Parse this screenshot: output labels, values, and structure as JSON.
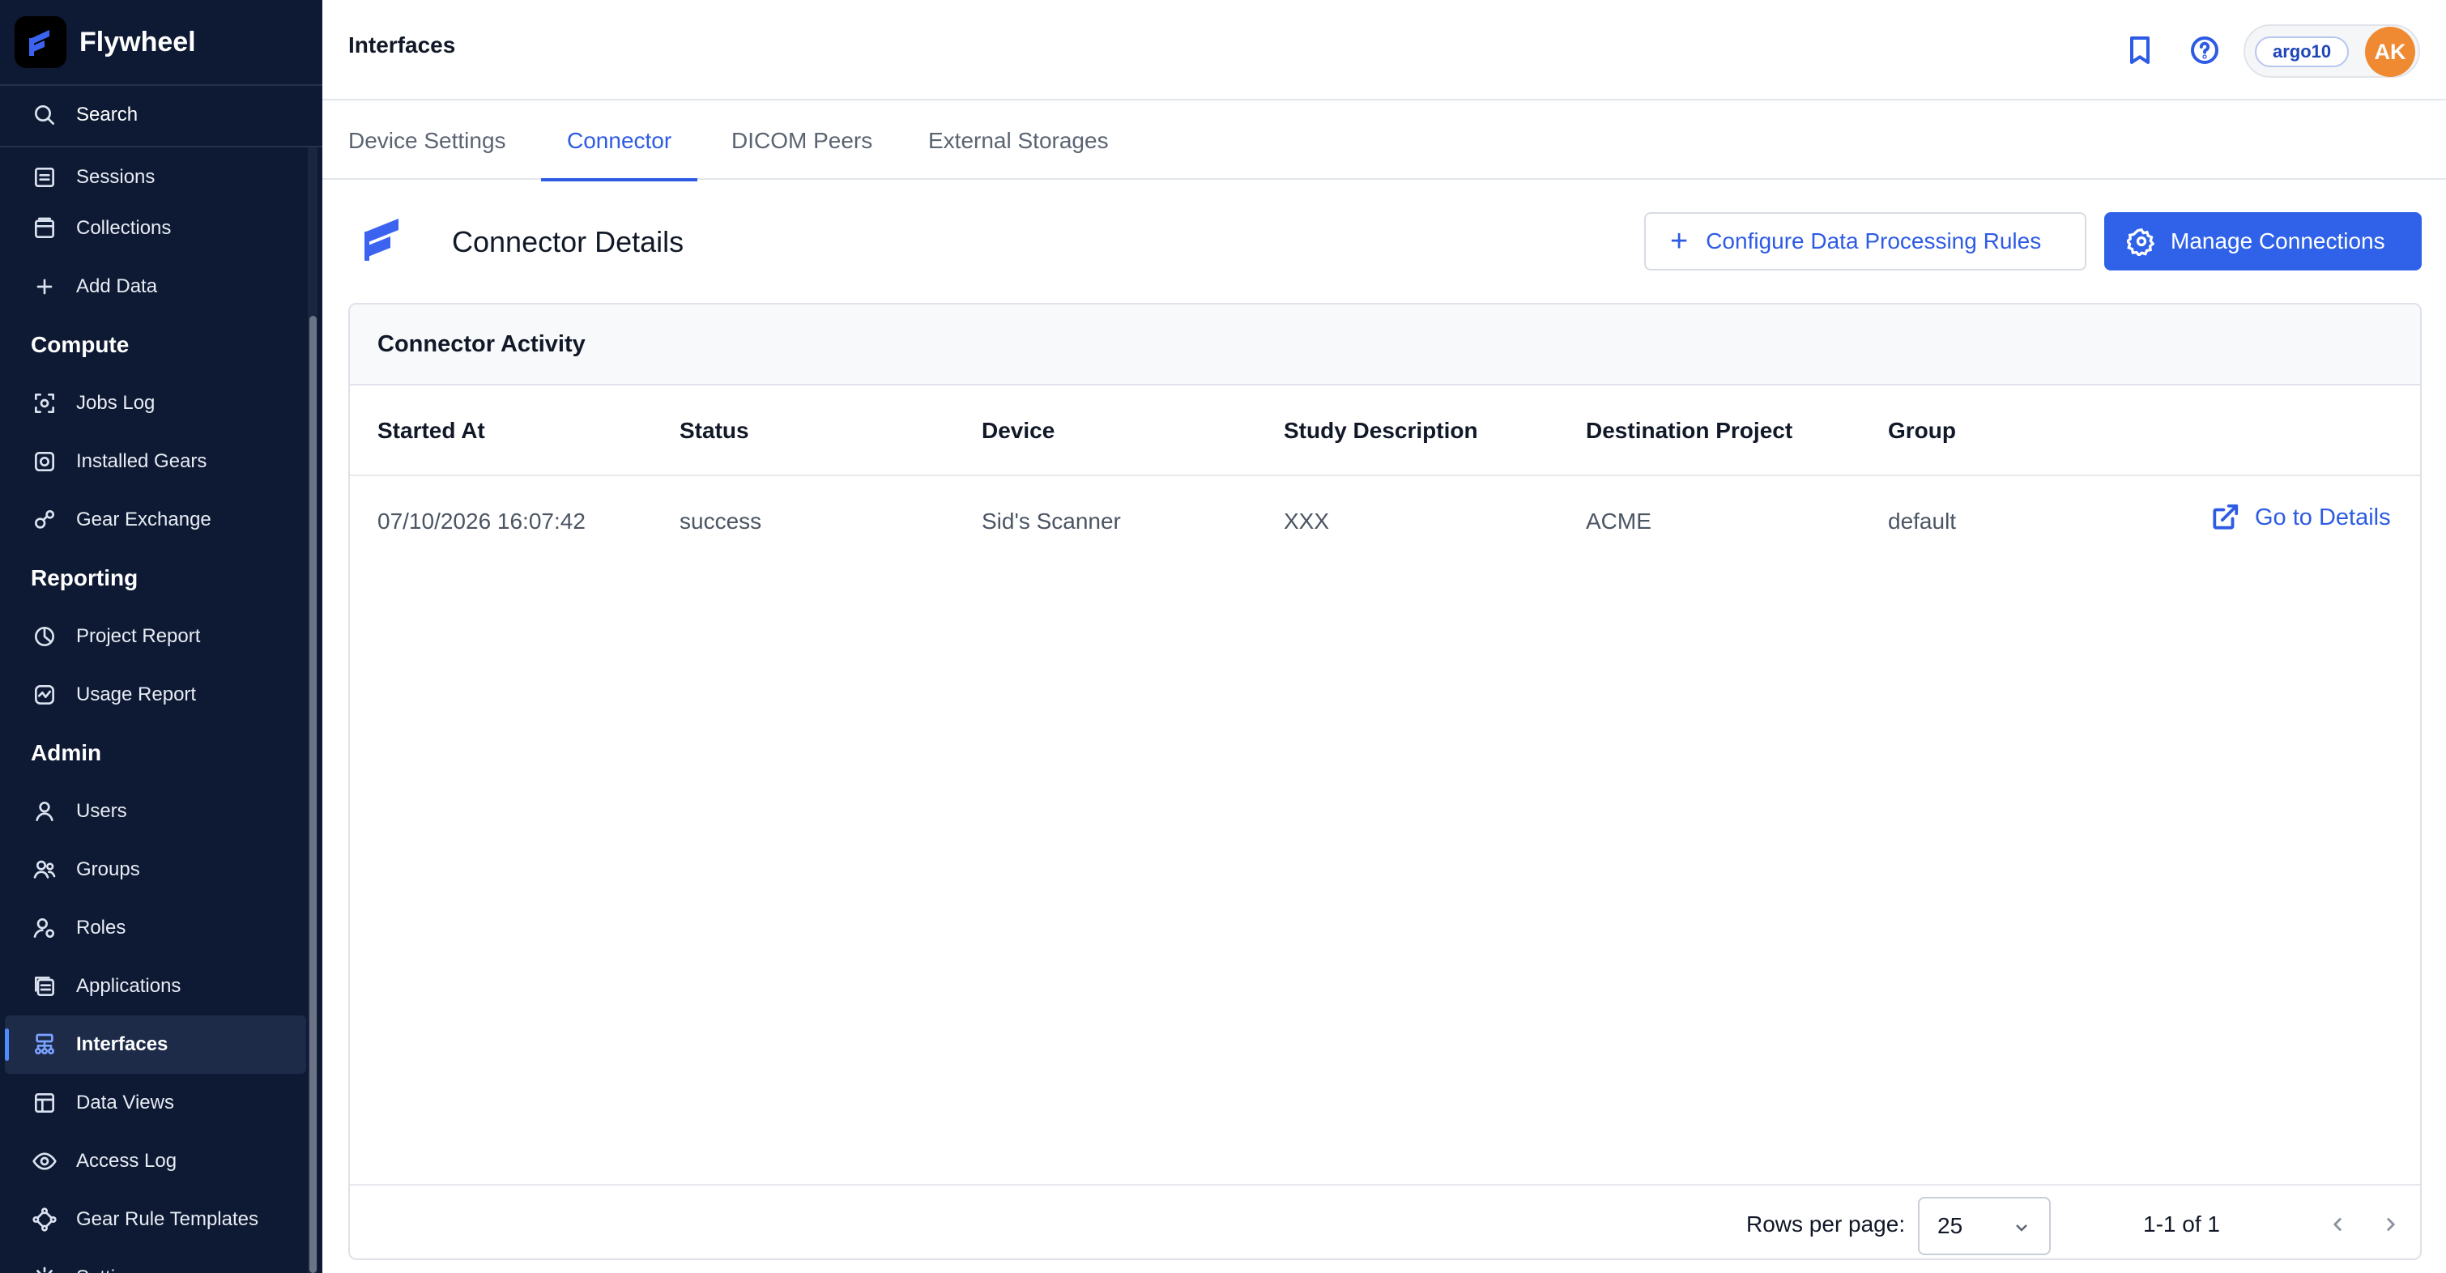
{
  "app": {
    "name": "Flywheel"
  },
  "sidebar": {
    "search_label": "Search",
    "items_top": [
      {
        "label": "Sessions",
        "icon": "sessions-icon"
      },
      {
        "label": "Collections",
        "icon": "collections-icon"
      },
      {
        "label": "Add Data",
        "icon": "plus-icon"
      }
    ],
    "compute_heading": "Compute",
    "compute": [
      {
        "label": "Jobs Log",
        "icon": "jobs-log-icon"
      },
      {
        "label": "Installed Gears",
        "icon": "installed-gears-icon"
      },
      {
        "label": "Gear Exchange",
        "icon": "gear-exchange-icon"
      }
    ],
    "reporting_heading": "Reporting",
    "reporting": [
      {
        "label": "Project Report",
        "icon": "project-report-icon"
      },
      {
        "label": "Usage Report",
        "icon": "usage-report-icon"
      }
    ],
    "admin_heading": "Admin",
    "admin": [
      {
        "label": "Users",
        "icon": "user-icon"
      },
      {
        "label": "Groups",
        "icon": "groups-icon"
      },
      {
        "label": "Roles",
        "icon": "roles-icon"
      },
      {
        "label": "Applications",
        "icon": "applications-icon"
      },
      {
        "label": "Interfaces",
        "icon": "interfaces-icon",
        "active": true
      },
      {
        "label": "Data Views",
        "icon": "data-views-icon"
      },
      {
        "label": "Access Log",
        "icon": "eye-icon"
      },
      {
        "label": "Gear Rule Templates",
        "icon": "gear-rule-templates-icon"
      },
      {
        "label": "Settings",
        "icon": "settings-icon"
      }
    ]
  },
  "header": {
    "title": "Interfaces",
    "org_badge": "argo10",
    "avatar_initials": "AK",
    "avatar_color": "#ef8a33"
  },
  "tabs": [
    {
      "label": "Device Settings"
    },
    {
      "label": "Connector",
      "active": true
    },
    {
      "label": "DICOM Peers"
    },
    {
      "label": "External Storages"
    }
  ],
  "section": {
    "title": "Connector Details",
    "configure_button": "Configure Data Processing Rules",
    "manage_button": "Manage Connections"
  },
  "activity": {
    "title": "Connector Activity",
    "columns": [
      "Started At",
      "Status",
      "Device",
      "Study Description",
      "Destination Project",
      "Group"
    ],
    "rows": [
      {
        "started_at": "07/10/2026 16:07:42",
        "status": "success",
        "device": "Sid's Scanner",
        "study_description": "XXX",
        "destination_project": "ACME",
        "group": "default",
        "link": "Go to Details"
      }
    ],
    "footer": {
      "rows_per_page_label": "Rows per page:",
      "rows_per_page_value": "25",
      "range": "1-1 of 1"
    }
  },
  "colors": {
    "accent": "#2d5be3",
    "primary_button": "#2f62e8",
    "sidebar_bg": "#0e1a33"
  }
}
